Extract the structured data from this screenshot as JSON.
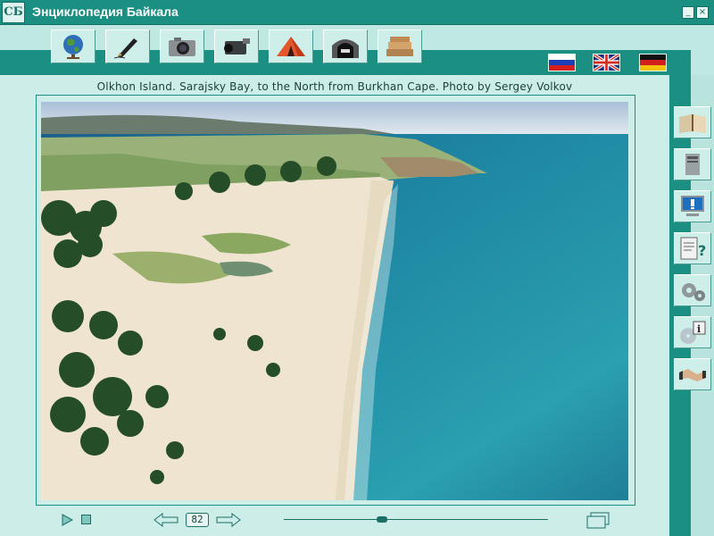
{
  "window": {
    "title": "Энциклопедия Байкала",
    "logo_text": "СБ",
    "minimize_label": "_",
    "close_label": "×"
  },
  "toolbar": {
    "items": [
      {
        "name": "globe-icon"
      },
      {
        "name": "pen-icon"
      },
      {
        "name": "camera-icon"
      },
      {
        "name": "video-camera-icon"
      },
      {
        "name": "tent-icon"
      },
      {
        "name": "tunnel-icon"
      },
      {
        "name": "books-icon"
      }
    ]
  },
  "languages": [
    {
      "name": "russian-flag"
    },
    {
      "name": "english-flag"
    },
    {
      "name": "german-flag"
    }
  ],
  "photo": {
    "caption": "Olkhon Island. Sarajsky Bay, to the North from Burkhan Cape. Photo by Sergey Volkov"
  },
  "sidebar": {
    "items": [
      {
        "name": "open-book-icon"
      },
      {
        "name": "computer-tower-icon"
      },
      {
        "name": "monitor-alert-icon"
      },
      {
        "name": "help-document-icon"
      },
      {
        "name": "gears-icon"
      },
      {
        "name": "cd-info-icon"
      },
      {
        "name": "handshake-icon"
      }
    ]
  },
  "player": {
    "page_number": "82",
    "slider_position": 0.37
  }
}
